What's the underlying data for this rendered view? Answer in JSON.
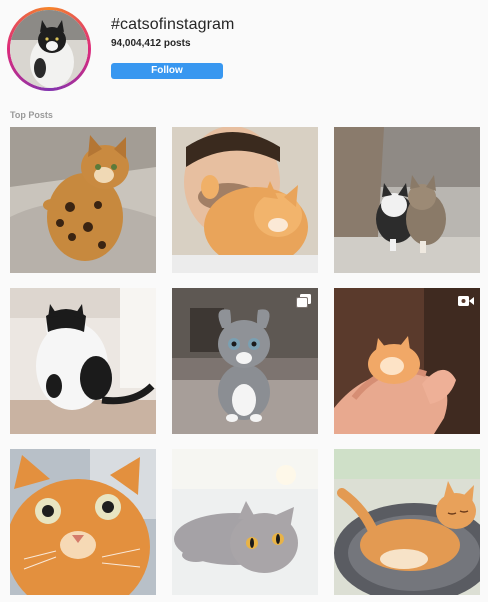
{
  "header": {
    "hashtag": "#catsofinstagram",
    "post_count": "94,004,412",
    "post_count_suffix": "posts",
    "follow_label": "Follow"
  },
  "sections": {
    "top_posts_label": "Top Posts"
  },
  "colors": {
    "follow_button": "#3897f0",
    "background": "#fafafa",
    "section_label": "#999999"
  },
  "posts": [
    {
      "subject": "bengal kitten lying on blanket",
      "media": "photo"
    },
    {
      "subject": "man hugging orange kitten",
      "media": "photo"
    },
    {
      "subject": "two kittens by a tree",
      "media": "photo"
    },
    {
      "subject": "black and white cat sitting upright",
      "media": "photo"
    },
    {
      "subject": "grey and white kitten with curled ears",
      "media": "carousel",
      "badge_icon": "carousel-icon"
    },
    {
      "subject": "tiny orange kitten held in hand",
      "media": "video",
      "badge_icon": "video-icon"
    },
    {
      "subject": "orange cat close-up selfie",
      "media": "photo"
    },
    {
      "subject": "grey british shorthair lying down",
      "media": "photo"
    },
    {
      "subject": "orange cat sleeping on cat bed",
      "media": "photo"
    }
  ]
}
